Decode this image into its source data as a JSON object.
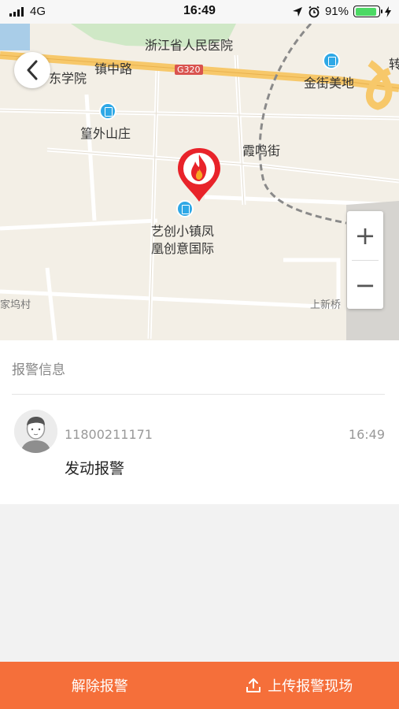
{
  "status_bar": {
    "carrier": "4G",
    "time": "16:49",
    "battery_percent": "91%",
    "battery_level": 0.91
  },
  "map": {
    "labels": {
      "hospital": "浙江省人民医院",
      "road": "镇中路",
      "route_shield": "G320",
      "college": "东学院",
      "jinjie": "金街美地",
      "huangwai": "篁外山庄",
      "xiaming": "霞鸣街",
      "yichuang_line1": "艺创小镇凤",
      "yichuang_line2": "凰创意国际",
      "village": "家坞村",
      "shangxinqiao": "上新桥",
      "edge": "转"
    },
    "zoom_in_label": "+",
    "zoom_out_label": "−"
  },
  "alarm": {
    "section_title": "报警信息",
    "phone": "11800211171",
    "time": "16:49",
    "message": "发动报警"
  },
  "actions": {
    "dismiss_label": "解除报警",
    "upload_label": "上传报警现场"
  },
  "colors": {
    "accent": "#f56f3a",
    "marker": "#e8232a",
    "poi": "#2ea8e6",
    "battery": "#4cd964"
  }
}
